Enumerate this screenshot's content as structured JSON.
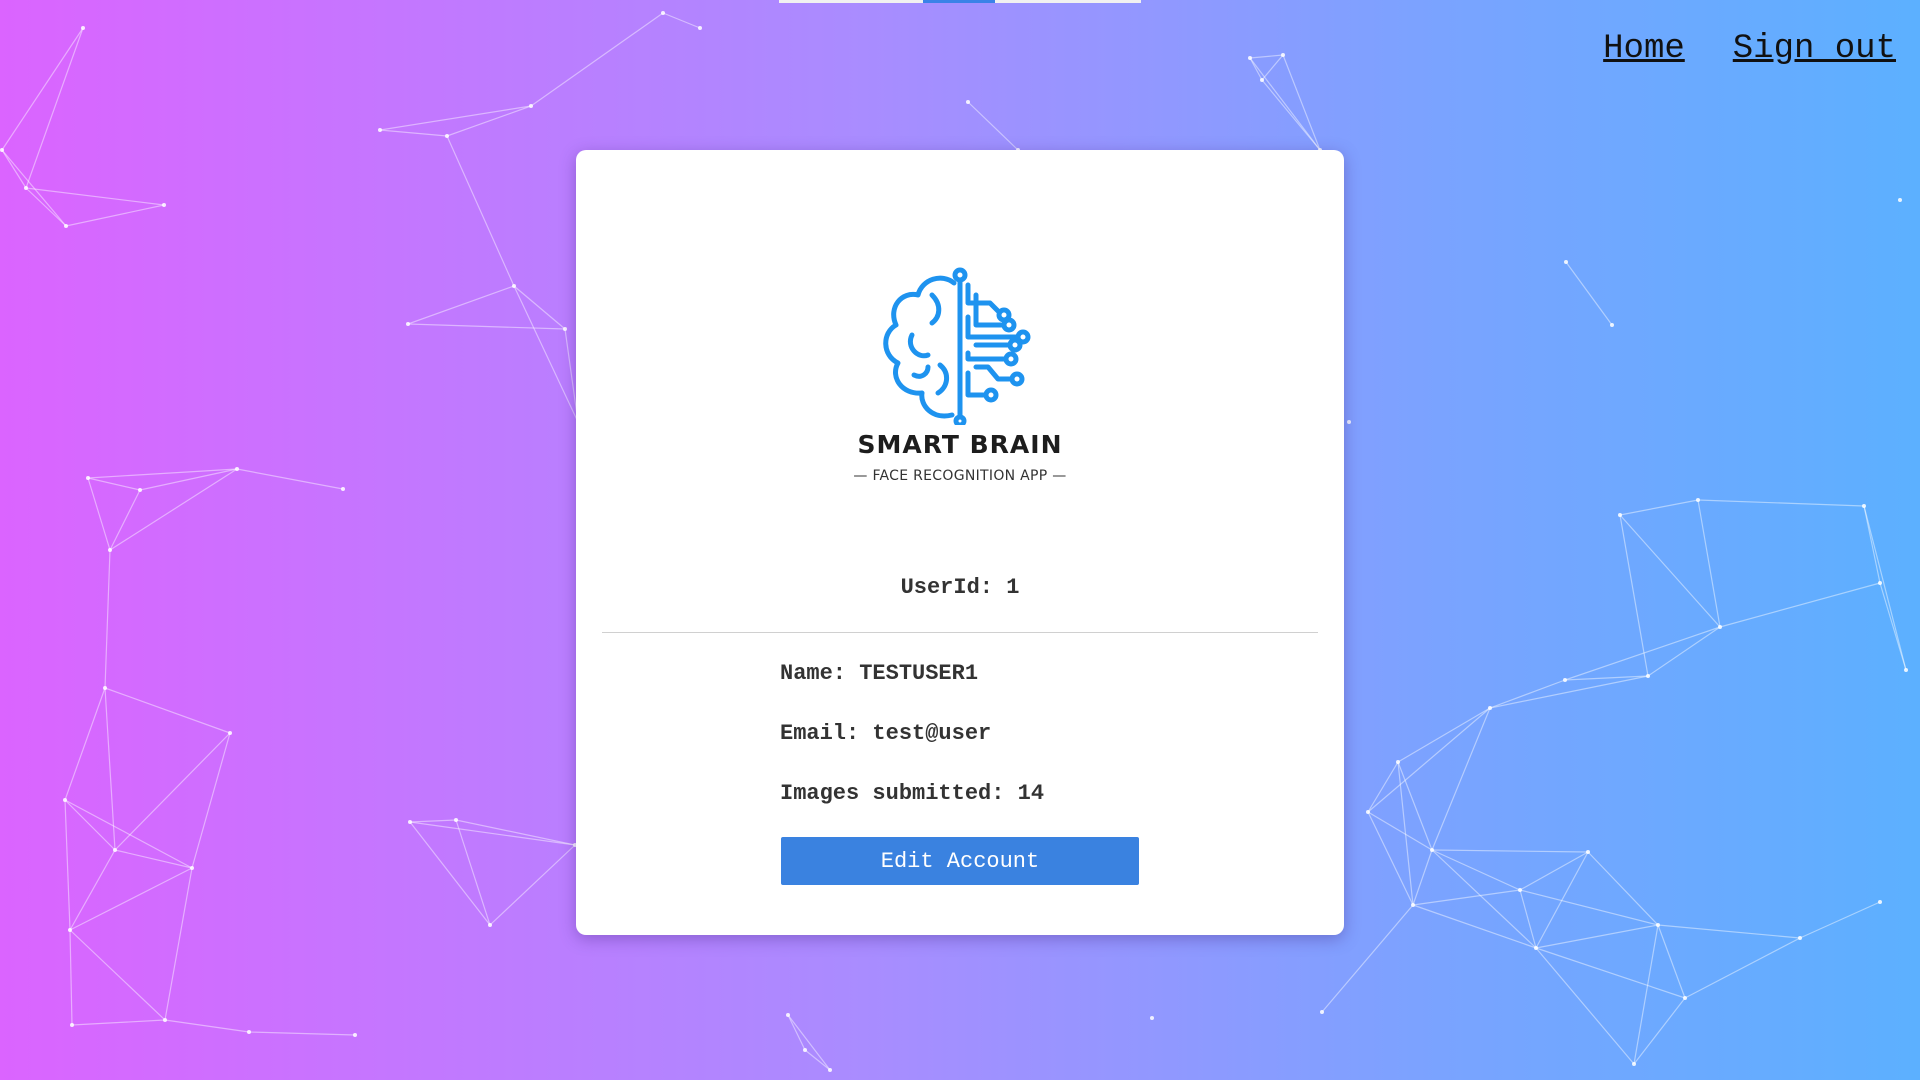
{
  "nav": {
    "home": "Home",
    "signout": "Sign out"
  },
  "logo": {
    "title": "SMART BRAIN",
    "subtitle": "— FACE RECOGNITION APP —"
  },
  "profile": {
    "userid": "UserId: 1",
    "name": "Name: TESTUSER1",
    "email": "Email: test@user",
    "images": "Images submitted: 14"
  },
  "button": {
    "edit": "Edit Account"
  },
  "colors": {
    "accent": "#3a82e0",
    "logo_blue": "#1e93ef",
    "gradient_left": "#db64ff",
    "gradient_right": "#5cb0ff"
  }
}
